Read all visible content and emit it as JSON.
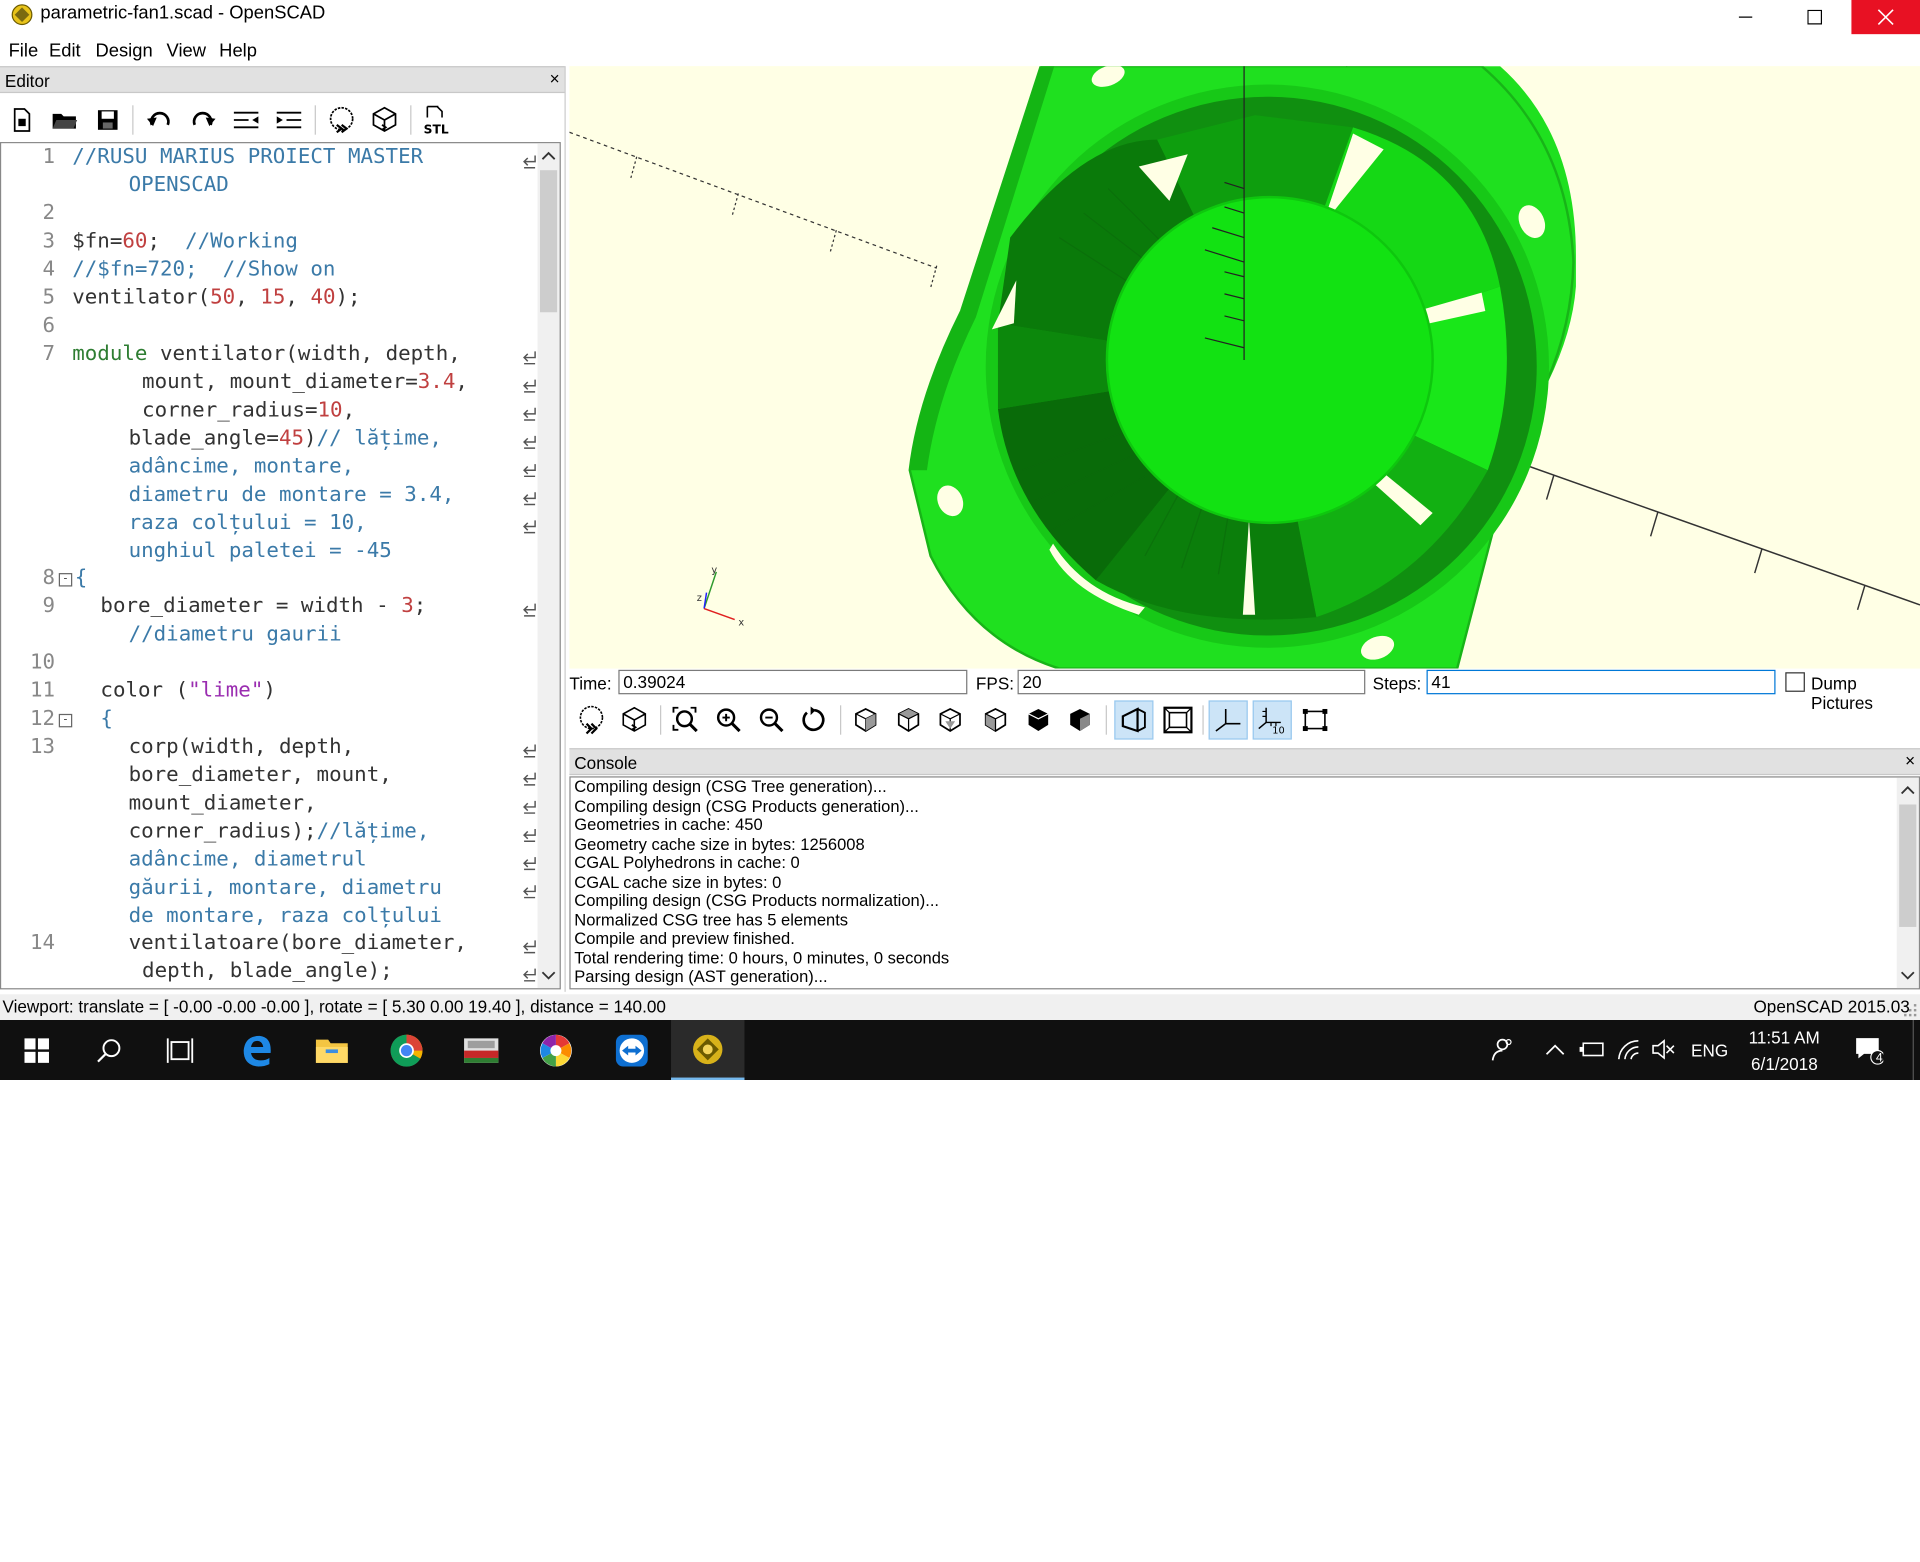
{
  "window": {
    "title": "parametric-fan1.scad - OpenSCAD",
    "minimize": "—",
    "maximize": "☐",
    "close": "✕"
  },
  "menu": [
    "File",
    "Edit",
    "Design",
    "View",
    "Help"
  ],
  "editor": {
    "title": "Editor",
    "close": "×",
    "toolbar": [
      "new-file",
      "open-file",
      "save-file",
      "undo",
      "redo",
      "unindent",
      "indent",
      "preview",
      "render",
      "export-stl"
    ],
    "stl_label": "STL",
    "line_numbers": [
      "1",
      "2",
      "3",
      "4",
      "5",
      "6",
      "7",
      "8",
      "9",
      "10",
      "11",
      "12",
      "13",
      "14"
    ],
    "code": {
      "l1a": "//RUSU MARIUS PROIECT MASTER",
      "l1b": "OPENSCAD",
      "l3a": "$fn=",
      "l3b": "60",
      "l3c": ";  ",
      "l3d": "//Working",
      "l4": "//$fn=720;  //Show on",
      "l5a": "ventilator(",
      "l5b": "50",
      "l5c": ", ",
      "l5d": "15",
      "l5e": ", ",
      "l5f": "40",
      "l5g": ");",
      "l7a": "module",
      "l7b": " ventilator(width, depth,",
      "l7c": "mount, mount_diameter=",
      "l7d": "3.4",
      "l7e": ",",
      "l7f": "corner_radius=",
      "l7g": "10",
      "l7h": ",",
      "l7i": "blade_angle=",
      "l7j": "45",
      "l7k": ")",
      "l7l": "// lățime,",
      "l7m": "adâncime, montare,",
      "l7n": "diametru de montare = 3.4,",
      "l7o": "raza colțului = 10,",
      "l7p": "unghiul paletei = -45",
      "l8": "{",
      "l9a": "bore_diameter = width - ",
      "l9b": "3",
      "l9c": ";",
      "l9d": "//diametru gaurii",
      "l11a": "color (",
      "l11b": "\"lime\"",
      "l11c": ")",
      "l12": "{",
      "l13a": "corp(width, depth,",
      "l13b": "bore_diameter, mount,",
      "l13c": "mount_diameter,",
      "l13d": "corner_radius);",
      "l13e": "//lățime,",
      "l13f": "adâncime, diametrul",
      "l13g": "găurii, montare, diametru",
      "l13h": "de montare, raza colțului",
      "l14a": "ventilatoare(bore_diameter,",
      "l14b": "depth, blade_angle);"
    }
  },
  "animate": {
    "time_label": "Time:",
    "time_value": "0.39024",
    "fps_label": "FPS:",
    "fps_value": "20",
    "steps_label": "Steps:",
    "steps_value": "41",
    "dump_label": "Dump Pictures"
  },
  "view_toolbar": [
    "preview",
    "render",
    "view-all",
    "zoom-in",
    "zoom-out",
    "reset-view",
    "view-right",
    "view-top",
    "view-bottom",
    "view-left",
    "view-front",
    "view-back",
    "perspective",
    "orthogonal",
    "show-axes",
    "show-scale-markers",
    "show-edges"
  ],
  "view_toolbar_scale_label": "10",
  "console": {
    "title": "Console",
    "close": "×",
    "lines": [
      "Compiling design (CSG Tree generation)...",
      "Compiling design (CSG Products generation)...",
      "Geometries in cache: 450",
      "Geometry cache size in bytes: 1256008",
      "CGAL Polyhedrons in cache: 0",
      "CGAL cache size in bytes: 0",
      "Compiling design (CSG Products normalization)...",
      "Normalized CSG tree has 5 elements",
      "Compile and preview finished.",
      "Total rendering time: 0 hours, 0 minutes, 0 seconds",
      "Parsing design (AST generation)..."
    ]
  },
  "statusbar": {
    "viewport": "Viewport: translate = [ -0.00 -0.00 -0.00 ], rotate = [ 5.30 0.00 19.40 ], distance = 140.00",
    "version": "OpenSCAD 2015.03"
  },
  "viewport": {
    "background": "#ffffe5",
    "model_color": "#00ff00",
    "axis_labels": {
      "x": "x",
      "y": "y",
      "z": "z"
    }
  },
  "taskbar": {
    "apps": [
      "start",
      "search",
      "task-view",
      "edge",
      "file-explorer",
      "chrome",
      "photo-app",
      "picasa",
      "teamviewer",
      "openscad"
    ],
    "language": "ENG",
    "time": "11:51 AM",
    "date": "6/1/2018",
    "notifications": "4"
  }
}
